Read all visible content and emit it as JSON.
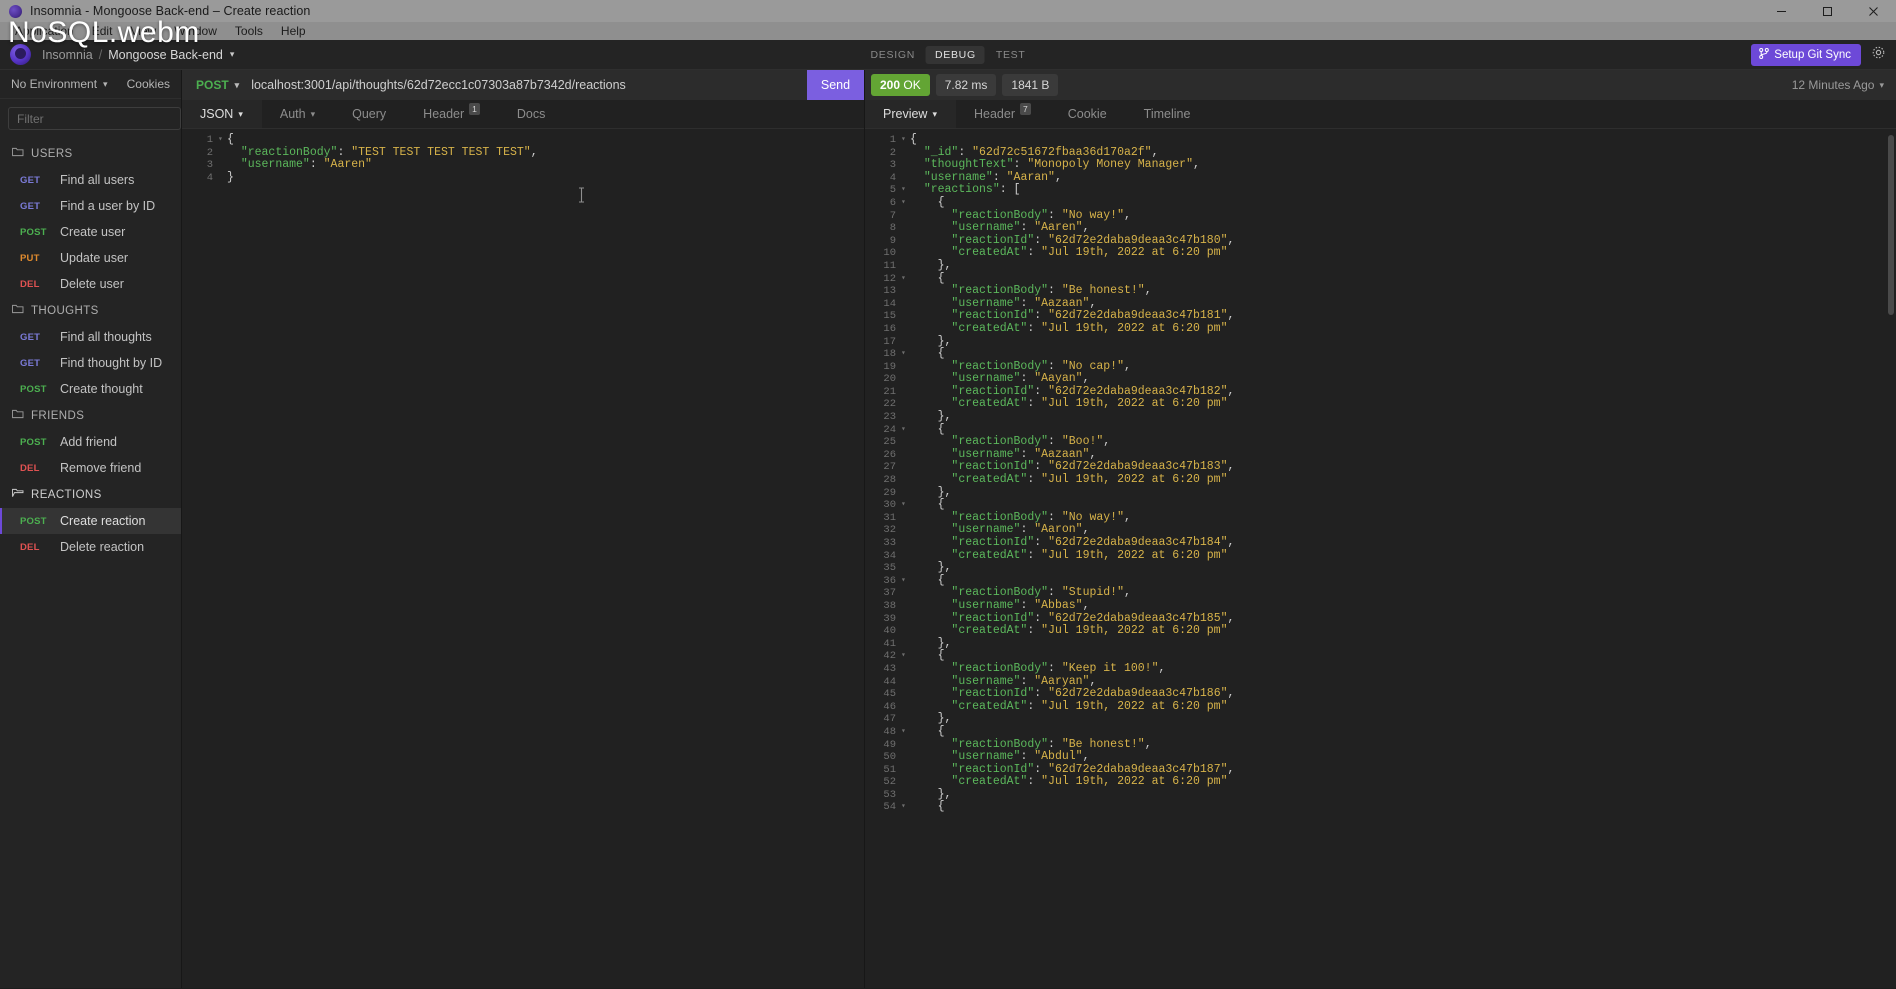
{
  "window": {
    "title": "Insomnia - Mongoose Back-end – Create reaction",
    "controls": {
      "minimize": "minimize-icon",
      "maximize": "maximize-icon",
      "close": "close-icon"
    }
  },
  "watermark": "NoSQL.webm",
  "menubar": [
    "Application",
    "Edit",
    "View",
    "Window",
    "Tools",
    "Help"
  ],
  "header": {
    "breadcrumb_root": "Insomnia",
    "breadcrumb_sep": "/",
    "breadcrumb_active": "Mongoose Back-end",
    "caret": "▾",
    "modes": [
      {
        "label": "DESIGN",
        "active": false
      },
      {
        "label": "DEBUG",
        "active": true
      },
      {
        "label": "TEST",
        "active": false
      }
    ],
    "git_sync_label": "Setup Git Sync",
    "git_icon": "git-branch-icon",
    "settings_icon": "gear-icon",
    "accent": "#6d49d8"
  },
  "sidebar": {
    "environment": "No Environment",
    "environment_caret": "▾",
    "cookies": "Cookies",
    "filter_placeholder": "Filter",
    "sort_icon": "sort-icon",
    "add_icon": "plus-circle-icon",
    "groups": [
      {
        "name": "USERS",
        "icon": "folder-icon",
        "items": [
          {
            "verb": "GET",
            "name": "Find all users",
            "selected": false
          },
          {
            "verb": "GET",
            "name": "Find a user by ID",
            "selected": false
          },
          {
            "verb": "POST",
            "name": "Create user",
            "selected": false
          },
          {
            "verb": "PUT",
            "name": "Update user",
            "selected": false
          },
          {
            "verb": "DEL",
            "name": "Delete user",
            "selected": false
          }
        ]
      },
      {
        "name": "THOUGHTS",
        "icon": "folder-icon",
        "items": [
          {
            "verb": "GET",
            "name": "Find all thoughts",
            "selected": false
          },
          {
            "verb": "GET",
            "name": "Find thought by ID",
            "selected": false
          },
          {
            "verb": "POST",
            "name": "Create thought",
            "selected": false
          }
        ]
      },
      {
        "name": "FRIENDS",
        "icon": "folder-icon",
        "items": [
          {
            "verb": "POST",
            "name": "Add friend",
            "selected": false
          },
          {
            "verb": "DEL",
            "name": "Remove friend",
            "selected": false
          }
        ]
      },
      {
        "name": "REACTIONS",
        "icon": "folder-open-icon",
        "active": true,
        "items": [
          {
            "verb": "POST",
            "name": "Create reaction",
            "selected": true
          },
          {
            "verb": "DEL",
            "name": "Delete reaction",
            "selected": false
          }
        ]
      }
    ]
  },
  "request": {
    "method": "POST",
    "method_caret": "▾",
    "url": "localhost:3001/api/thoughts/62d72ecc1c07303a87b7342d/reactions",
    "send_label": "Send",
    "tabs": [
      {
        "label": "JSON",
        "caret": "▾",
        "active": true,
        "count": null
      },
      {
        "label": "Auth",
        "caret": "▾",
        "active": false,
        "count": null
      },
      {
        "label": "Query",
        "caret": "",
        "active": false,
        "count": null
      },
      {
        "label": "Header",
        "caret": "",
        "active": false,
        "count": "1"
      },
      {
        "label": "Docs",
        "caret": "",
        "active": false,
        "count": null
      }
    ],
    "body_lines": [
      {
        "n": 1,
        "fold": true,
        "indent": 0,
        "tokens": [
          [
            "punc",
            "{"
          ]
        ]
      },
      {
        "n": 2,
        "fold": false,
        "indent": 1,
        "tokens": [
          [
            "key",
            "\"reactionBody\""
          ],
          [
            "punc",
            ": "
          ],
          [
            "str",
            "\"TEST TEST TEST TEST TEST\""
          ],
          [
            "punc",
            ","
          ]
        ]
      },
      {
        "n": 3,
        "fold": false,
        "indent": 1,
        "tokens": [
          [
            "key",
            "\"username\""
          ],
          [
            "punc",
            ": "
          ],
          [
            "str",
            "\"Aaren\""
          ]
        ]
      },
      {
        "n": 4,
        "fold": false,
        "indent": 0,
        "tokens": [
          [
            "punc",
            "}"
          ]
        ]
      }
    ]
  },
  "response": {
    "status": {
      "code": "200",
      "text": "OK"
    },
    "time": "7.82 ms",
    "size": "1841 B",
    "time_ago": "12 Minutes Ago",
    "time_ago_caret": "▾",
    "tabs": [
      {
        "label": "Preview",
        "caret": "▾",
        "active": true,
        "count": null
      },
      {
        "label": "Header",
        "caret": "",
        "active": false,
        "count": "7"
      },
      {
        "label": "Cookie",
        "caret": "",
        "active": false,
        "count": null
      },
      {
        "label": "Timeline",
        "caret": "",
        "active": false,
        "count": null
      }
    ],
    "json": {
      "_id": "62d72c51672fbaa36d170a2f",
      "thoughtText": "Monopoly Money Manager",
      "username": "Aaran",
      "reactions": [
        {
          "reactionBody": "No way!",
          "username": "Aaren",
          "reactionId": "62d72e2daba9deaa3c47b180",
          "createdAt": "Jul 19th, 2022 at 6:20 pm"
        },
        {
          "reactionBody": "Be honest!",
          "username": "Aazaan",
          "reactionId": "62d72e2daba9deaa3c47b181",
          "createdAt": "Jul 19th, 2022 at 6:20 pm"
        },
        {
          "reactionBody": "No cap!",
          "username": "Aayan",
          "reactionId": "62d72e2daba9deaa3c47b182",
          "createdAt": "Jul 19th, 2022 at 6:20 pm"
        },
        {
          "reactionBody": "Boo!",
          "username": "Aazaan",
          "reactionId": "62d72e2daba9deaa3c47b183",
          "createdAt": "Jul 19th, 2022 at 6:20 pm"
        },
        {
          "reactionBody": "No way!",
          "username": "Aaron",
          "reactionId": "62d72e2daba9deaa3c47b184",
          "createdAt": "Jul 19th, 2022 at 6:20 pm"
        },
        {
          "reactionBody": "Stupid!",
          "username": "Abbas",
          "reactionId": "62d72e2daba9deaa3c47b185",
          "createdAt": "Jul 19th, 2022 at 6:20 pm"
        },
        {
          "reactionBody": "Keep it 100!",
          "username": "Aaryan",
          "reactionId": "62d72e2daba9deaa3c47b186",
          "createdAt": "Jul 19th, 2022 at 6:20 pm"
        },
        {
          "reactionBody": "Be honest!",
          "username": "Abdul",
          "reactionId": "62d72e2daba9deaa3c47b187",
          "createdAt": "Jul 19th, 2022 at 6:20 pm"
        }
      ]
    }
  }
}
